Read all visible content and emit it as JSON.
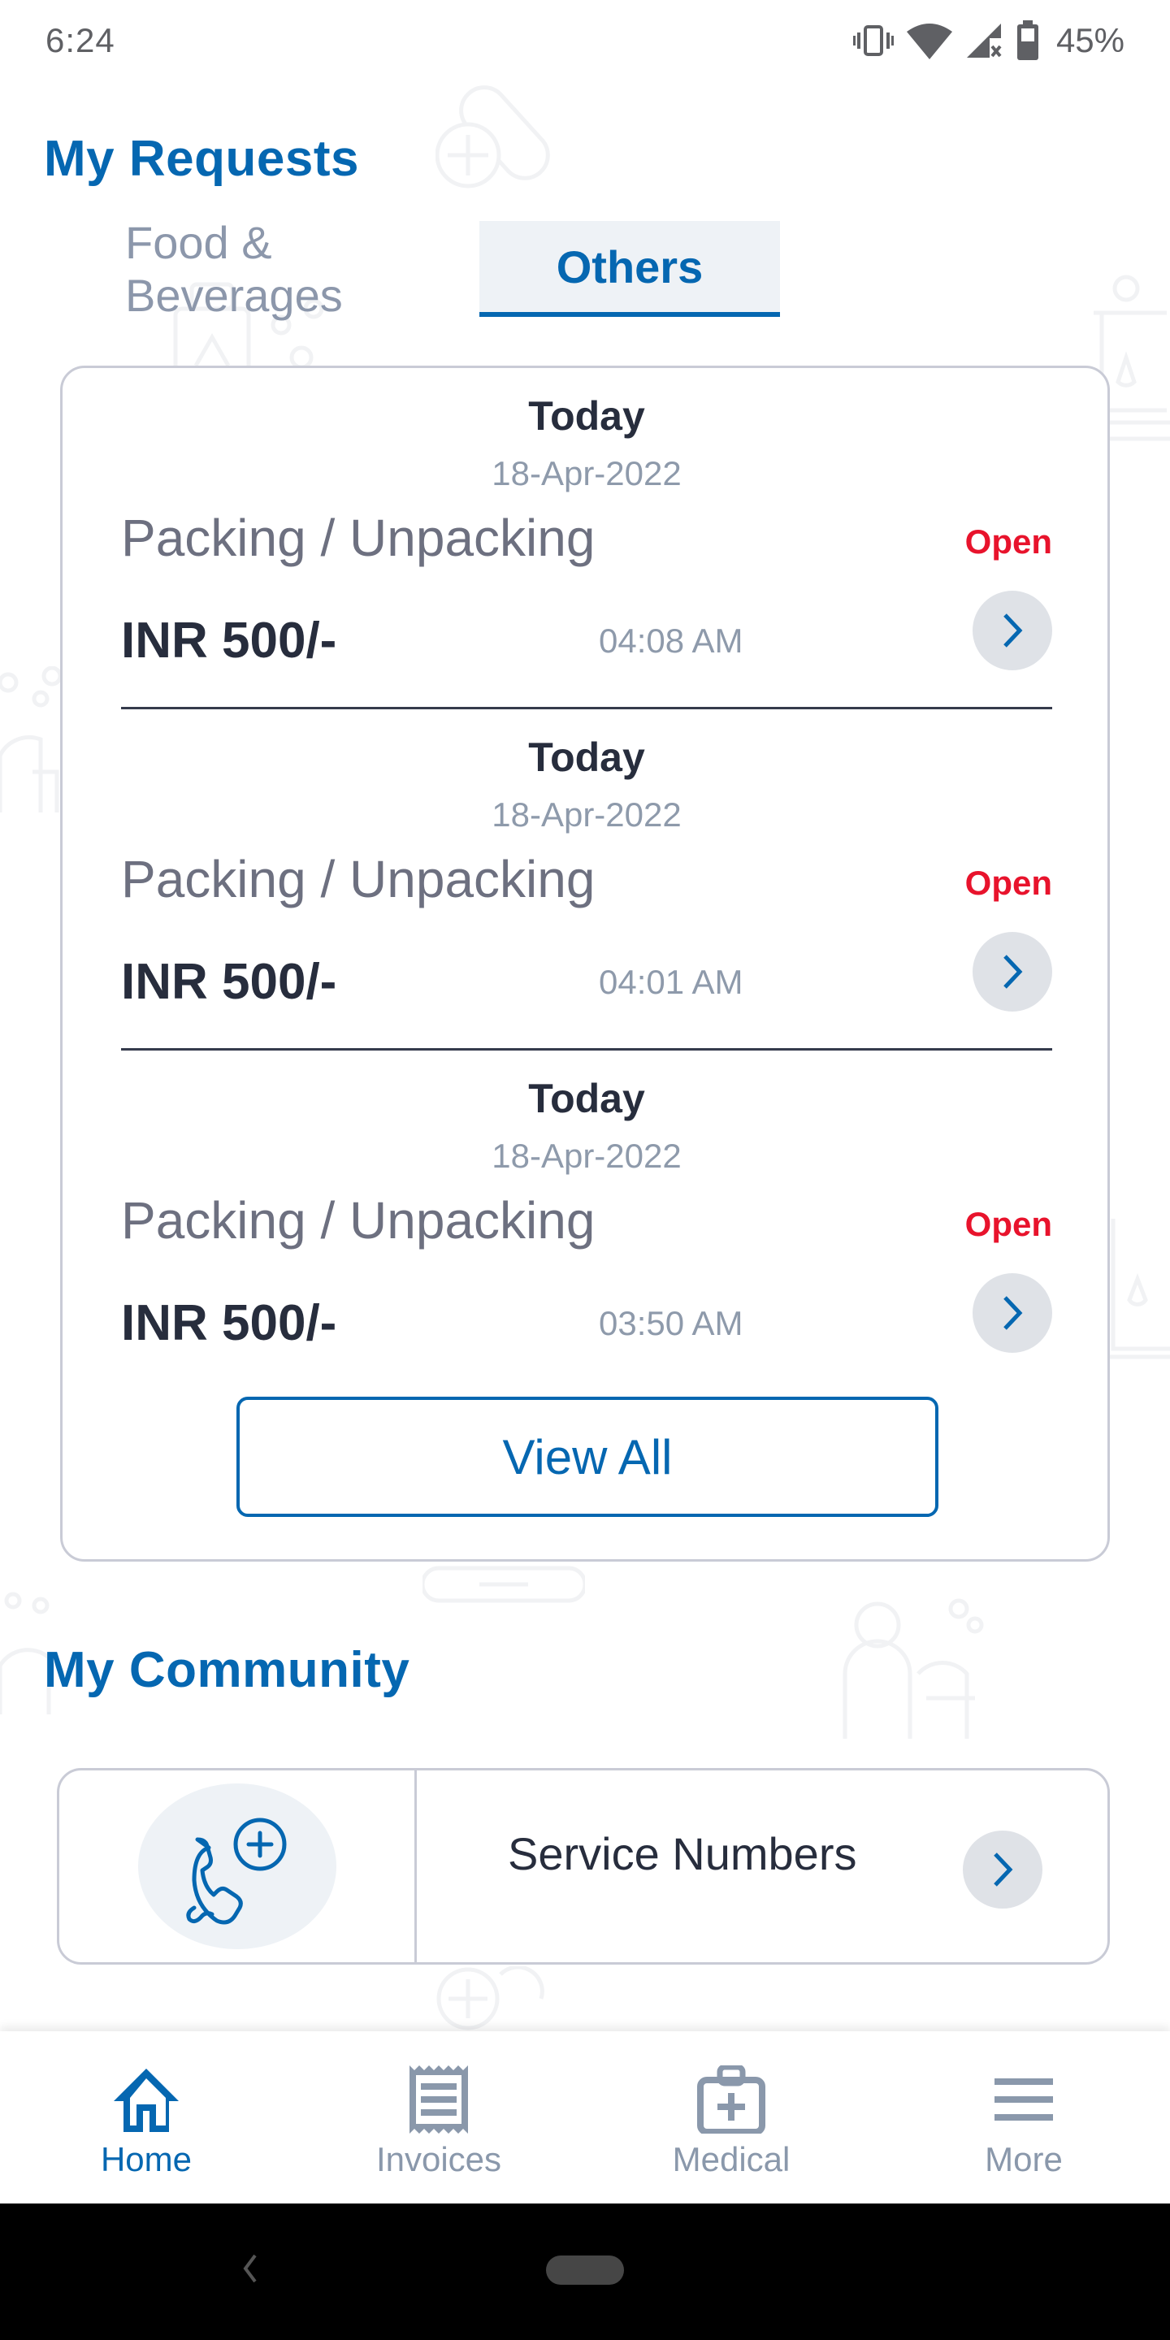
{
  "status_bar": {
    "time": "6:24",
    "icons": [
      "vibrate-icon",
      "wifi-icon",
      "cellular-no-signal-icon",
      "battery-icon"
    ],
    "battery_percent": "45%"
  },
  "requests": {
    "title": "My Requests",
    "tabs": [
      {
        "label": "Food & Beverages",
        "active": false
      },
      {
        "label": "Others",
        "active": true
      }
    ],
    "items": [
      {
        "day": "Today",
        "date": "18-Apr-2022",
        "service": "Packing / Unpacking",
        "status": "Open",
        "amount": "INR 500/-",
        "time": "04:08 AM"
      },
      {
        "day": "Today",
        "date": "18-Apr-2022",
        "service": "Packing / Unpacking",
        "status": "Open",
        "amount": "INR 500/-",
        "time": "04:01 AM"
      },
      {
        "day": "Today",
        "date": "18-Apr-2022",
        "service": "Packing / Unpacking",
        "status": "Open",
        "amount": "INR 500/-",
        "time": "03:50 AM"
      }
    ],
    "view_all_label": "View All"
  },
  "community": {
    "title": "My Community",
    "items": [
      {
        "label": "Service Numbers",
        "icon": "phone-medical-icon"
      }
    ]
  },
  "bottom_nav": {
    "items": [
      {
        "label": "Home",
        "icon": "home-icon",
        "active": true
      },
      {
        "label": "Invoices",
        "icon": "receipt-icon",
        "active": false
      },
      {
        "label": "Medical",
        "icon": "medical-kit-icon",
        "active": false
      },
      {
        "label": "More",
        "icon": "menu-icon",
        "active": false
      }
    ]
  },
  "colors": {
    "brand": "#0567b1",
    "status_open": "#e8132c",
    "muted_text": "#8e9aab",
    "dark_text": "#272d3d"
  }
}
